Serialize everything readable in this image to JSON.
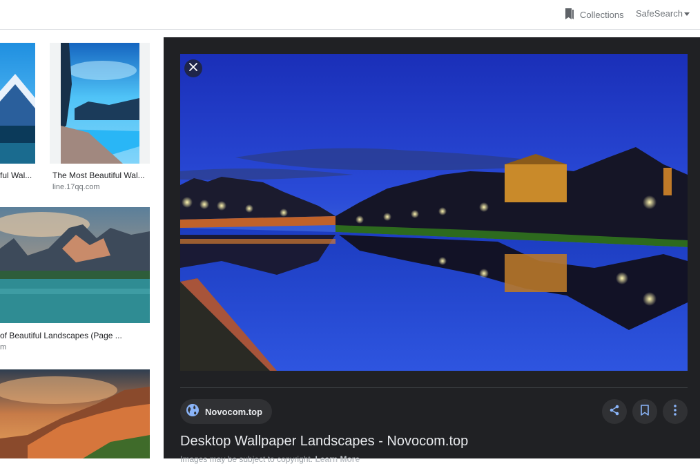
{
  "header": {
    "collections_label": "Collections",
    "safesearch_label": "SafeSearch"
  },
  "results": [
    {
      "title": "ful Wal...",
      "source": ""
    },
    {
      "title": "The Most Beautiful Wal...",
      "source": "line.17qq.com"
    },
    {
      "title": "of Beautiful Landscapes (Page ...",
      "source": "m"
    }
  ],
  "preview": {
    "site": "Novocom.top",
    "title": "Desktop Wallpaper Landscapes - Novocom.top",
    "copyright_text": "Images may be subject to copyright.",
    "learn_more": "Learn More"
  },
  "colors": {
    "panel_bg": "#202124",
    "chip_bg": "#303134",
    "accent_blue": "#8ab4f8"
  },
  "icons": [
    "bookmark-icon",
    "caret-down-icon",
    "close-icon",
    "globe-icon",
    "share-icon",
    "save-icon",
    "more-vert-icon"
  ]
}
